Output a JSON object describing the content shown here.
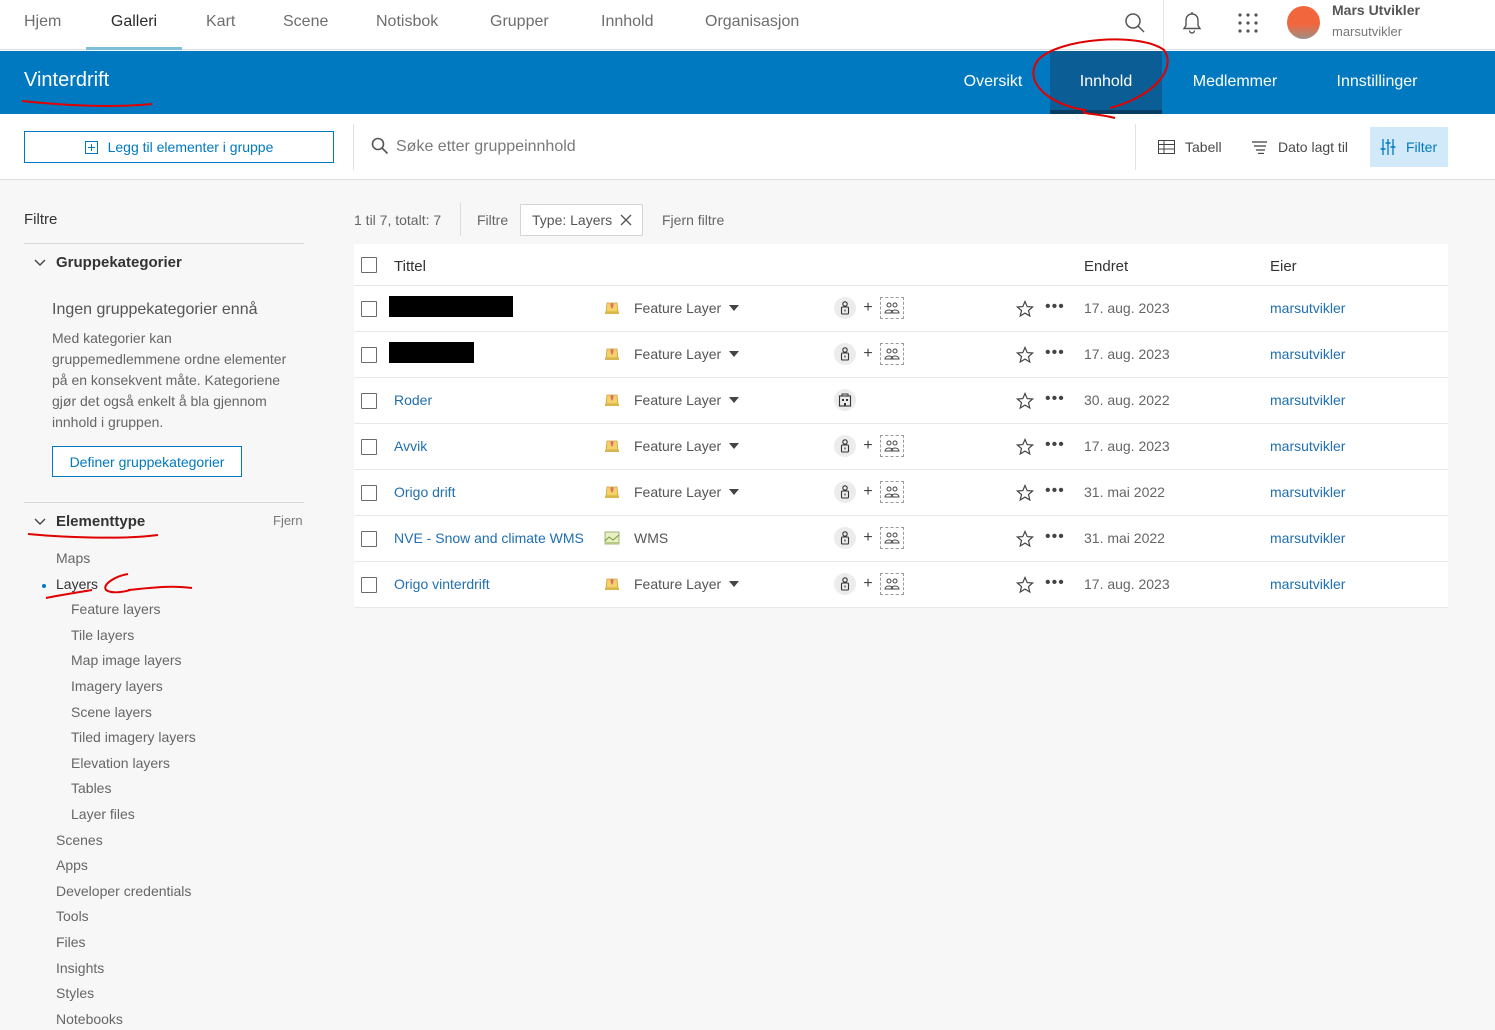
{
  "topnav": {
    "items": [
      {
        "label": "Hjem",
        "active": false
      },
      {
        "label": "Galleri",
        "active": true
      },
      {
        "label": "Kart",
        "active": false
      },
      {
        "label": "Scene",
        "active": false
      },
      {
        "label": "Notisbok",
        "active": false
      },
      {
        "label": "Grupper",
        "active": false
      },
      {
        "label": "Innhold",
        "active": false
      },
      {
        "label": "Organisasjon",
        "active": false
      }
    ],
    "icons": [
      "search-icon",
      "bell-icon",
      "app-launcher-icon"
    ],
    "user": {
      "name": "Mars Utvikler",
      "handle": "marsutvikler"
    }
  },
  "group": {
    "title": "Vinterdrift",
    "tabs": [
      {
        "label": "Oversikt",
        "active": false
      },
      {
        "label": "Innhold",
        "active": true
      },
      {
        "label": "Medlemmer",
        "active": false
      },
      {
        "label": "Innstillinger",
        "active": false
      }
    ]
  },
  "toolbar": {
    "add_label": "Legg til elementer i gruppe",
    "search_placeholder": "Søke etter gruppeinnhold",
    "view_label": "Tabell",
    "sort_label": "Dato lagt til",
    "filter_label": "Filter"
  },
  "sidebar": {
    "title": "Filtre",
    "categories": {
      "heading": "Gruppekategorier",
      "empty_title": "Ingen gruppekategorier ennå",
      "empty_text": "Med kategorier kan gruppemedlemmene ordne elementer på en konsekvent måte. Kategoriene gjør det også enkelt å bla gjennom innhold i gruppen.",
      "define_label": "Definer gruppekategorier"
    },
    "item_type": {
      "heading": "Elementtype",
      "remove_label": "Fjern",
      "items": [
        {
          "label": "Maps",
          "level": 0
        },
        {
          "label": "Layers",
          "level": 0,
          "selected": true
        },
        {
          "label": "Feature layers",
          "level": 1
        },
        {
          "label": "Tile layers",
          "level": 1
        },
        {
          "label": "Map image layers",
          "level": 1
        },
        {
          "label": "Imagery layers",
          "level": 1
        },
        {
          "label": "Scene layers",
          "level": 1
        },
        {
          "label": "Tiled imagery layers",
          "level": 1
        },
        {
          "label": "Elevation layers",
          "level": 1
        },
        {
          "label": "Tables",
          "level": 1
        },
        {
          "label": "Layer files",
          "level": 1
        },
        {
          "label": "Scenes",
          "level": 0
        },
        {
          "label": "Apps",
          "level": 0
        },
        {
          "label": "Developer credentials",
          "level": 0
        },
        {
          "label": "Tools",
          "level": 0
        },
        {
          "label": "Files",
          "level": 0
        },
        {
          "label": "Insights",
          "level": 0
        },
        {
          "label": "Styles",
          "level": 0
        },
        {
          "label": "Notebooks",
          "level": 0
        }
      ]
    }
  },
  "results": {
    "count_text": "1 til 7, totalt: 7",
    "filters_label": "Filtre",
    "chip_label": "Type: Layers",
    "clear_label": "Fjern filtre",
    "columns": {
      "title": "Tittel",
      "modified": "Endret",
      "owner": "Eier"
    },
    "rows": [
      {
        "title": "",
        "redacted": true,
        "type": "Feature Layer",
        "type_icon": "feature-layer-icon",
        "sharing": "private",
        "modified": "17. aug. 2023",
        "owner": "marsutvikler"
      },
      {
        "title": "",
        "redacted": true,
        "type": "Feature Layer",
        "type_icon": "feature-layer-icon",
        "sharing": "private",
        "modified": "17. aug. 2023",
        "owner": "marsutvikler"
      },
      {
        "title": "Roder",
        "redacted": false,
        "type": "Feature Layer",
        "type_icon": "feature-layer-icon",
        "sharing": "organization",
        "modified": "30. aug. 2022",
        "owner": "marsutvikler"
      },
      {
        "title": "Avvik",
        "redacted": false,
        "type": "Feature Layer",
        "type_icon": "feature-layer-icon",
        "sharing": "private",
        "modified": "17. aug. 2023",
        "owner": "marsutvikler"
      },
      {
        "title": "Origo drift",
        "redacted": false,
        "type": "Feature Layer",
        "type_icon": "feature-layer-icon",
        "sharing": "private",
        "modified": "31. mai 2022",
        "owner": "marsutvikler"
      },
      {
        "title": "NVE - Snow and climate WMS",
        "redacted": false,
        "type": "WMS",
        "type_icon": "wms-icon",
        "sharing": "private",
        "modified": "31. mai 2022",
        "owner": "marsutvikler"
      },
      {
        "title": "Origo vinterdrift",
        "redacted": false,
        "type": "Feature Layer",
        "type_icon": "feature-layer-icon",
        "sharing": "private",
        "modified": "17. aug. 2023",
        "owner": "marsutvikler"
      }
    ]
  },
  "colors": {
    "brand": "#0079c1",
    "annotation": "#e00000"
  }
}
